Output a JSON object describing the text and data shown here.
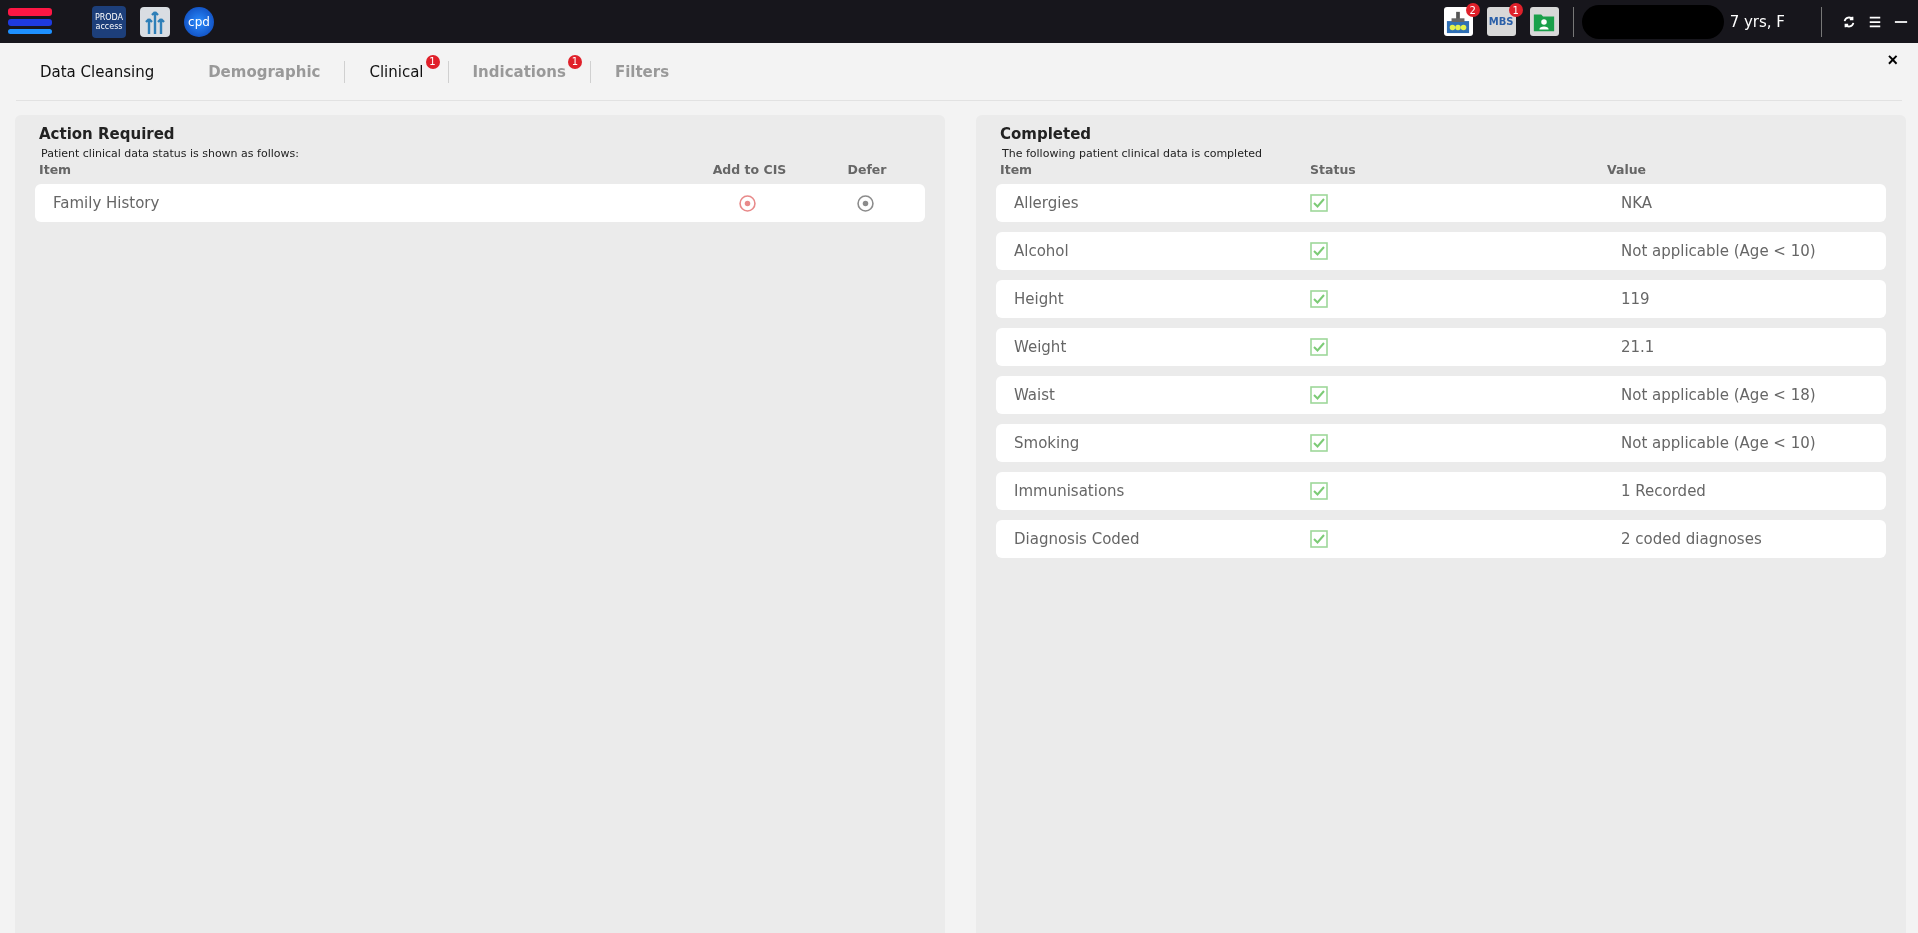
{
  "topbar": {
    "apps": [
      {
        "kind": "proda",
        "label": "PRODA",
        "sublabel": "access"
      },
      {
        "kind": "arrows"
      },
      {
        "kind": "cpd",
        "label": "cpd"
      }
    ],
    "tools": [
      {
        "kind": "meter",
        "badge": "2",
        "selected": true
      },
      {
        "kind": "mbs",
        "label": "MBS",
        "badge": "1",
        "selected": false
      },
      {
        "kind": "folder",
        "selected": false
      }
    ],
    "patient": {
      "summary": "7 yrs, F"
    }
  },
  "title": "Data Cleansing",
  "tabs": [
    {
      "label": "Demographic",
      "selected": false
    },
    {
      "label": "Clinical",
      "selected": true,
      "badge": "1"
    },
    {
      "label": "Indications",
      "selected": false,
      "badge": "1"
    },
    {
      "label": "Filters",
      "selected": false
    }
  ],
  "close": "×",
  "action_required": {
    "title": "Action Required",
    "subtitle": "Patient clinical data status is shown as follows:",
    "columns": [
      "Item",
      "Add to CIS",
      "Defer"
    ],
    "rows": [
      {
        "item": "Family History",
        "options": [
          {
            "color": "#e88a8a"
          },
          {
            "color": "#8c8c8c"
          }
        ]
      }
    ]
  },
  "completed": {
    "title": "Completed",
    "subtitle": "The following patient clinical data is completed",
    "columns": [
      "Item",
      "Status",
      "Value"
    ],
    "rows": [
      {
        "item": "Allergies",
        "checked": true,
        "value": "NKA"
      },
      {
        "item": "Alcohol",
        "checked": true,
        "value": "Not applicable (Age < 10)"
      },
      {
        "item": "Height",
        "checked": true,
        "value": "119"
      },
      {
        "item": "Weight",
        "checked": true,
        "value": "21.1"
      },
      {
        "item": "Waist",
        "checked": true,
        "value": "Not applicable (Age < 18)"
      },
      {
        "item": "Smoking",
        "checked": true,
        "value": "Not applicable (Age < 10)"
      },
      {
        "item": "Immunisations",
        "checked": true,
        "value": "1 Recorded"
      },
      {
        "item": "Diagnosis Coded",
        "checked": true,
        "value": "2 coded diagnoses"
      }
    ]
  }
}
